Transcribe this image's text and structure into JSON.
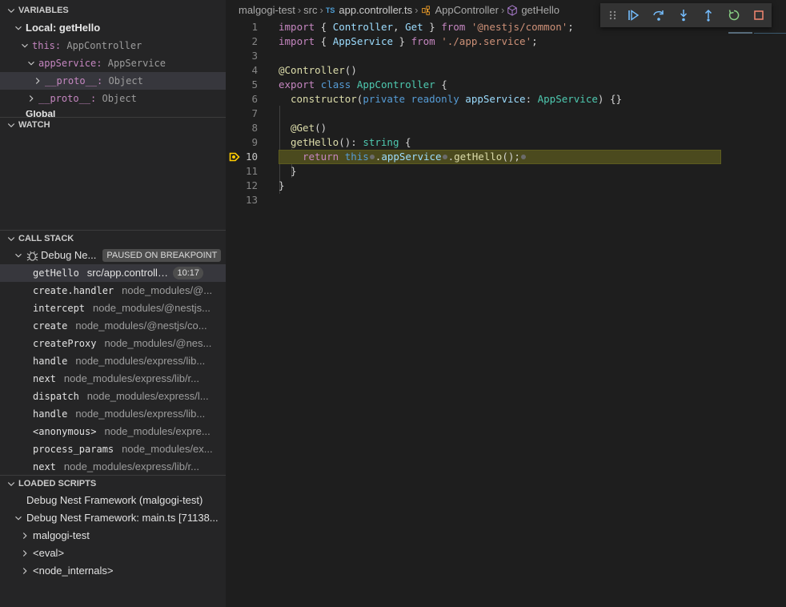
{
  "sidebar": {
    "variables": {
      "header": "VARIABLES",
      "rows": [
        {
          "label": "Local: getHello"
        },
        {
          "name": "this:",
          "value": "AppController"
        },
        {
          "name": "appService:",
          "value": "AppService"
        },
        {
          "name": "__proto__:",
          "value": "Object"
        },
        {
          "name": "__proto__:",
          "value": "Object"
        },
        {
          "label": "Global"
        }
      ]
    },
    "watch": {
      "header": "WATCH"
    },
    "call_stack": {
      "header": "CALL STACK",
      "session": "Debug Ne...",
      "session_badge": "PAUSED ON BREAKPOINT",
      "frames": [
        {
          "name": "getHello",
          "path": "src/app.controller.ts",
          "line": "10:17"
        },
        {
          "name": "create.handler",
          "path": "node_modules/@..."
        },
        {
          "name": "intercept",
          "path": "node_modules/@nestjs..."
        },
        {
          "name": "create",
          "path": "node_modules/@nestjs/co..."
        },
        {
          "name": "createProxy",
          "path": "node_modules/@nes..."
        },
        {
          "name": "handle",
          "path": "node_modules/express/lib..."
        },
        {
          "name": "next",
          "path": "node_modules/express/lib/r..."
        },
        {
          "name": "dispatch",
          "path": "node_modules/express/l..."
        },
        {
          "name": "handle",
          "path": "node_modules/express/lib..."
        },
        {
          "name": "<anonymous>",
          "path": "node_modules/expre..."
        },
        {
          "name": "process_params",
          "path": "node_modules/ex..."
        },
        {
          "name": "next",
          "path": "node_modules/express/lib/r..."
        }
      ]
    },
    "loaded_scripts": {
      "header": "LOADED SCRIPTS",
      "items": [
        "Debug Nest Framework (malgogi-test)",
        "Debug Nest Framework: main.ts [71138...",
        "malgogi-test",
        "<eval>",
        "<node_internals>"
      ]
    }
  },
  "breadcrumb": {
    "items": [
      "malgogi-test",
      "src",
      "app.controller.ts",
      "AppController",
      "getHello"
    ],
    "file_badge": "TS"
  },
  "debug_toolbar": {
    "icons": [
      "drag-handle-icon",
      "continue-icon",
      "step-over-icon",
      "step-into-icon",
      "step-out-icon",
      "restart-icon",
      "stop-icon"
    ]
  },
  "editor": {
    "current_line": 10,
    "line_numbers": [
      "1",
      "2",
      "3",
      "4",
      "5",
      "6",
      "7",
      "8",
      "9",
      "10",
      "11",
      "12",
      "13"
    ],
    "code": {
      "l1": [
        "import",
        " { ",
        "Controller",
        ", ",
        "Get",
        " } ",
        "from",
        " ",
        "'@nestjs/common'",
        ";"
      ],
      "l2": [
        "import",
        " { ",
        "AppService",
        " } ",
        "from",
        " ",
        "'./app.service'",
        ";"
      ],
      "l4": [
        "@",
        "Controller",
        "()"
      ],
      "l5": [
        "export",
        " ",
        "class",
        " ",
        "AppController",
        " {"
      ],
      "l6": [
        "constructor",
        "(",
        "private",
        " ",
        "readonly",
        " ",
        "appService",
        ": ",
        "AppService",
        ") {}"
      ],
      "l8": [
        "@",
        "Get",
        "()"
      ],
      "l9": [
        "getHello",
        "(): ",
        "string",
        " {"
      ],
      "l10": [
        "return",
        " ",
        "this",
        ".",
        "appService",
        ".",
        "getHello",
        "();"
      ],
      "l11": [
        "}"
      ],
      "l12": [
        "}"
      ]
    }
  },
  "colors": {
    "background": "#1e1e1e",
    "sidebar": "#252526",
    "highlight_line": "#4b4a1e",
    "breakpoint": "#ffcc00",
    "toolbar_blue": "#75beff",
    "toolbar_green": "#89d185",
    "toolbar_red": "#f48771"
  }
}
